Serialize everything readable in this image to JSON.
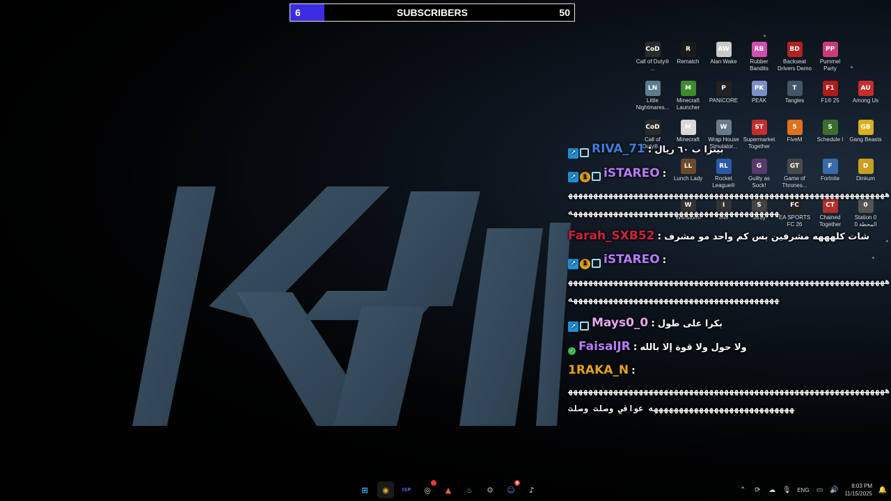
{
  "subscribers": {
    "current": "6",
    "label": "SUBSCRIBERS",
    "goal": "50",
    "progress_fraction": 0.12,
    "fill_color": "#3b2ce0"
  },
  "desktop_icons": [
    {
      "label": "Call of Duty® ...",
      "icon": "call-of-duty-icon",
      "color": "#2a2a2a",
      "glyph": "CoD"
    },
    {
      "label": "Rematch",
      "icon": "rematch-icon",
      "color": "#1a1a1a",
      "glyph": "R"
    },
    {
      "label": "Alan Wake",
      "icon": "alan-wake-icon",
      "color": "#c9c9c9",
      "glyph": "AW"
    },
    {
      "label": "Rubber Bandits",
      "icon": "rubber-bandits-icon",
      "color": "#d04fb0",
      "glyph": "RB"
    },
    {
      "label": "Backseat Drivers Demo",
      "icon": "backseat-drivers-icon",
      "color": "#b02323",
      "glyph": "BD"
    },
    {
      "label": "Pummel Party",
      "icon": "pummel-party-icon",
      "color": "#c83c7a",
      "glyph": "PP"
    },
    {
      "label": "",
      "icon": "empty-slot",
      "color": "transparent",
      "glyph": ""
    },
    {
      "label": "Little Nightmares...",
      "icon": "little-nightmares-icon",
      "color": "#5d7c8e",
      "glyph": "LN"
    },
    {
      "label": "Minecraft Launcher",
      "icon": "minecraft-launcher-icon",
      "color": "#3f8a2d",
      "glyph": "M"
    },
    {
      "label": "PANICORE",
      "icon": "panicore-icon",
      "color": "#222222",
      "glyph": "P"
    },
    {
      "label": "PEAK",
      "icon": "peak-icon",
      "color": "#7a8fc4",
      "glyph": "PK"
    },
    {
      "label": "Tangles",
      "icon": "tangles-icon",
      "color": "#445566",
      "glyph": "T"
    },
    {
      "label": "F1® 25",
      "icon": "f1-25-icon",
      "color": "#b01c1c",
      "glyph": "F1"
    },
    {
      "label": "Among Us",
      "icon": "among-us-icon",
      "color": "#c42e2e",
      "glyph": "AU"
    },
    {
      "label": "Call of Duty®...",
      "icon": "call-of-duty-2-icon",
      "color": "#2a2a2a",
      "glyph": "CoD"
    },
    {
      "label": "Minecraft",
      "icon": "minecraft-icon",
      "color": "#d8d8d8",
      "glyph": "M"
    },
    {
      "label": "Wrap House Simulator...",
      "icon": "wrap-house-icon",
      "color": "#6a7a8a",
      "glyph": "W"
    },
    {
      "label": "Supermarket Together",
      "icon": "supermarket-together-icon",
      "color": "#c42e2e",
      "glyph": "ST"
    },
    {
      "label": "FiveM",
      "icon": "fivem-icon",
      "color": "#e07020",
      "glyph": "5"
    },
    {
      "label": "Schedule I",
      "icon": "schedule-i-icon",
      "color": "#3b6e2e",
      "glyph": "S"
    },
    {
      "label": "Gang Beasts",
      "icon": "gang-beasts-icon",
      "color": "#d8b020",
      "glyph": "GB"
    },
    {
      "label": "",
      "icon": "empty-slot",
      "color": "transparent",
      "glyph": ""
    },
    {
      "label": "Lunch Lady",
      "icon": "lunch-lady-icon",
      "color": "#6b4a2a",
      "glyph": "LL"
    },
    {
      "label": "Rocket League®",
      "icon": "rocket-league-icon",
      "color": "#2a5aa8",
      "glyph": "RL"
    },
    {
      "label": "Guilty as Sock!",
      "icon": "guilty-as-sock-icon",
      "color": "#5a3a6a",
      "glyph": "G"
    },
    {
      "label": "Game of Thrones...",
      "icon": "game-of-thrones-icon",
      "color": "#4a4a4a",
      "glyph": "GT"
    },
    {
      "label": "Fortnite",
      "icon": "fortnite-icon",
      "color": "#3a6aa8",
      "glyph": "F"
    },
    {
      "label": "Dinkum",
      "icon": "dinkum-icon",
      "color": "#c8a020",
      "glyph": "D"
    },
    {
      "label": "",
      "icon": "empty-slot",
      "color": "transparent",
      "glyph": ""
    },
    {
      "label": "Withstorm",
      "icon": "withstorm-icon",
      "color": "#333333",
      "glyph": "W"
    },
    {
      "label": "Into",
      "icon": "into-icon",
      "color": "#333333",
      "glyph": "I"
    },
    {
      "label": "Stray",
      "icon": "stray-icon",
      "color": "#444444",
      "glyph": "S"
    },
    {
      "label": "EA SPORTS FC 26",
      "icon": "ea-fc-26-icon",
      "color": "#222222",
      "glyph": "FC"
    },
    {
      "label": "Chained Together",
      "icon": "chained-together-icon",
      "color": "#b03030",
      "glyph": "CT"
    },
    {
      "label": "Station 0 المحطة 0",
      "icon": "station-0-icon",
      "color": "#555555",
      "glyph": "0"
    }
  ],
  "chat": [
    {
      "badges": [
        "arrow",
        "grid"
      ],
      "username": "RIVA_71",
      "color": "#3b7ee0",
      "text": "بيتزا ب ٦٠ ريال",
      "spam": ""
    },
    {
      "badges": [
        "arrow",
        "one",
        "grid"
      ],
      "username": "iSTAREO",
      "color": "#b87bff",
      "text": "",
      "spam": "هههههههههههههههههههههههههههههههههههههههههههههههههههههههههههههههههههههههههههههههههههههههههههههههههههههههههه"
    },
    {
      "badges": [],
      "username": "Farah_SXB52",
      "color": "#d0233b",
      "text": "شات كلهههه مشرفين بس كم واحد مو مشرف",
      "spam": ""
    },
    {
      "badges": [
        "arrow",
        "one",
        "grid"
      ],
      "username": "iSTAREO",
      "color": "#b87bff",
      "text": "",
      "spam": "هههههههههههههههههههههههههههههههههههههههههههههههههههههههههههههههههههههههههههههههههههههههههههههههههههههههههه"
    },
    {
      "badges": [
        "arrow",
        "grid"
      ],
      "username": "Mays0_0",
      "color": "#e8a8f0",
      "text": "بكرا على طول",
      "spam": ""
    },
    {
      "badges": [
        "check"
      ],
      "username": "FaisalJR",
      "color": "#b87bff",
      "text": "ولا حول ولا قوة إلا بالله",
      "spam": ""
    },
    {
      "badges": [],
      "username": "1RAKA_N",
      "color": "#e8a317",
      "text": "",
      "spam": "ههههههههههههههههههههههههههههههههههههههههههههههههههههههههههههههههههههههههههههههههههههههههههههه عوافي وصلت وصلت"
    }
  ],
  "taskbar": {
    "apps": [
      {
        "name": "start-button",
        "glyph": "⊞",
        "color": "#4cc2ff"
      },
      {
        "name": "chrome-app",
        "glyph": "◉",
        "color": "#e8b020",
        "active": true
      },
      {
        "name": "isp-app",
        "glyph": "ISP",
        "color": "#4a6ad0"
      },
      {
        "name": "obs-app",
        "glyph": "◎",
        "color": "#d8d8d8",
        "notif": ""
      },
      {
        "name": "fivem-app",
        "glyph": "▲",
        "color": "#e07020"
      },
      {
        "name": "steam-app",
        "glyph": "♨",
        "color": "#8ab4d8"
      },
      {
        "name": "settings-app",
        "glyph": "⚙",
        "color": "#a8b4c4"
      },
      {
        "name": "discord-app",
        "glyph": "☺",
        "color": "#7289da",
        "notif": "9"
      },
      {
        "name": "tiktok-app",
        "glyph": "♪",
        "color": "#ffffff"
      }
    ],
    "tray": {
      "language": "ENG",
      "time": "8:03 PM",
      "date": "11/15/2025"
    }
  }
}
